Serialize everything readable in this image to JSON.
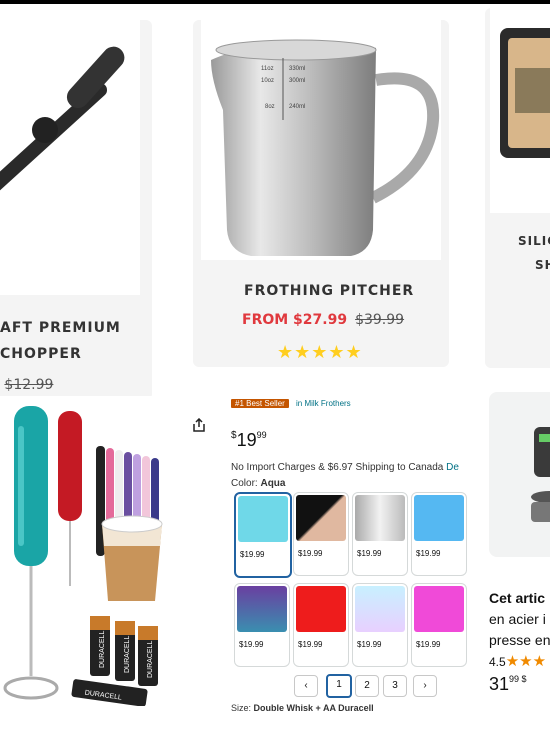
{
  "products": [
    {
      "title_line1": "AFT PREMIUM",
      "title_line2": "CHOPPER",
      "old_price": "$12.99"
    },
    {
      "title": "FROTHING PITCHER",
      "from_price": "FROM $27.99",
      "old_price": "$39.99",
      "rating": 5,
      "stars": "★★★★★",
      "pitcher_marks": [
        "11oz",
        "10oz",
        "330ml",
        "300ml",
        "8oz",
        "240ml"
      ]
    },
    {
      "title_line1": "SILIC",
      "title_line2": "SH"
    }
  ],
  "amazon": {
    "badge": "#1 Best Seller",
    "category_link": "in Milk Frothers",
    "price_symbol": "$",
    "price_whole": "19",
    "price_cents": "99",
    "shipping": "No Import Charges & $6.97 Shipping to Canada",
    "shipping_link": "De",
    "color_label": "Color:",
    "color_value": "Aqua",
    "battery_brand": "DURACELL",
    "swatches": [
      {
        "price": "$19.99",
        "color": "aqua"
      },
      {
        "price": "$19.99",
        "color": "black-gold"
      },
      {
        "price": "$19.99",
        "color": "silver"
      },
      {
        "price": "$19.99",
        "color": "blue"
      },
      {
        "price": "$19.99",
        "color": "purple-gradient"
      },
      {
        "price": "$19.99",
        "color": "red"
      },
      {
        "price": "$19.99",
        "color": "iridescent"
      },
      {
        "price": "$19.99",
        "color": "pink"
      }
    ],
    "pages": [
      "1",
      "2",
      "3"
    ],
    "prev_glyph": "‹",
    "next_glyph": "›",
    "size_label": "Size:",
    "size_value": "Double Whisk + AA Duracell"
  },
  "right_card": {
    "title": "Cet artic",
    "line2": "en acier i",
    "line3": "presse en",
    "rating": "4.5",
    "stars": "★★★",
    "price": "31",
    "cents": "99 $"
  }
}
